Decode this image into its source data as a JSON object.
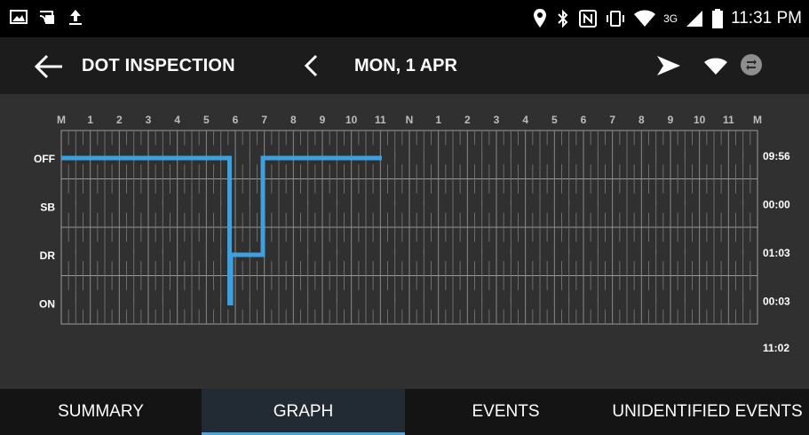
{
  "status_bar": {
    "time": "11:31 PM",
    "network": "3G"
  },
  "app_bar": {
    "title": "DOT INSPECTION",
    "date": "MON, 1 APR"
  },
  "graph": {
    "hour_labels": [
      "M",
      "1",
      "2",
      "3",
      "4",
      "5",
      "6",
      "7",
      "8",
      "9",
      "10",
      "11",
      "N",
      "1",
      "2",
      "3",
      "4",
      "5",
      "6",
      "7",
      "8",
      "9",
      "10",
      "11",
      "M"
    ],
    "rows": [
      {
        "label": "OFF",
        "total": "09:56"
      },
      {
        "label": "SB",
        "total": "00:00"
      },
      {
        "label": "DR",
        "total": "01:03"
      },
      {
        "label": "ON",
        "total": "00:03"
      }
    ],
    "grand_total": "11:02",
    "line_color": "#3fa0df",
    "status_timeline": [
      {
        "status": "OFF",
        "start": 0,
        "end": 5.8
      },
      {
        "status": "ON",
        "start": 5.8,
        "end": 5.85
      },
      {
        "status": "DR",
        "start": 5.85,
        "end": 6.95
      },
      {
        "status": "OFF",
        "start": 6.95,
        "end": 11.05
      }
    ]
  },
  "tabs": [
    {
      "label": "SUMMARY",
      "active": false
    },
    {
      "label": "GRAPH",
      "active": true
    },
    {
      "label": "EVENTS",
      "active": false
    },
    {
      "label": "UNIDENTIFIED EVENTS",
      "active": false
    }
  ],
  "colors": {
    "accent": "#49a3df",
    "background": "#303030",
    "app_bar": "#1c1c1c"
  }
}
